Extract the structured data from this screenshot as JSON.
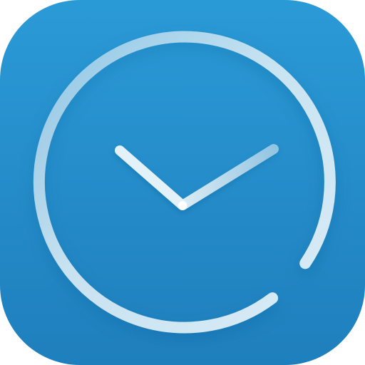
{
  "icon": {
    "name": "clock-icon",
    "colors": {
      "tile_top": "#2a9ad6",
      "tile_bottom": "#1f7fbd",
      "ring": "#d9ecf6",
      "ring_shadow": "#0e5f93",
      "hands": "#e3f1f8",
      "center": "#ffffff"
    }
  }
}
